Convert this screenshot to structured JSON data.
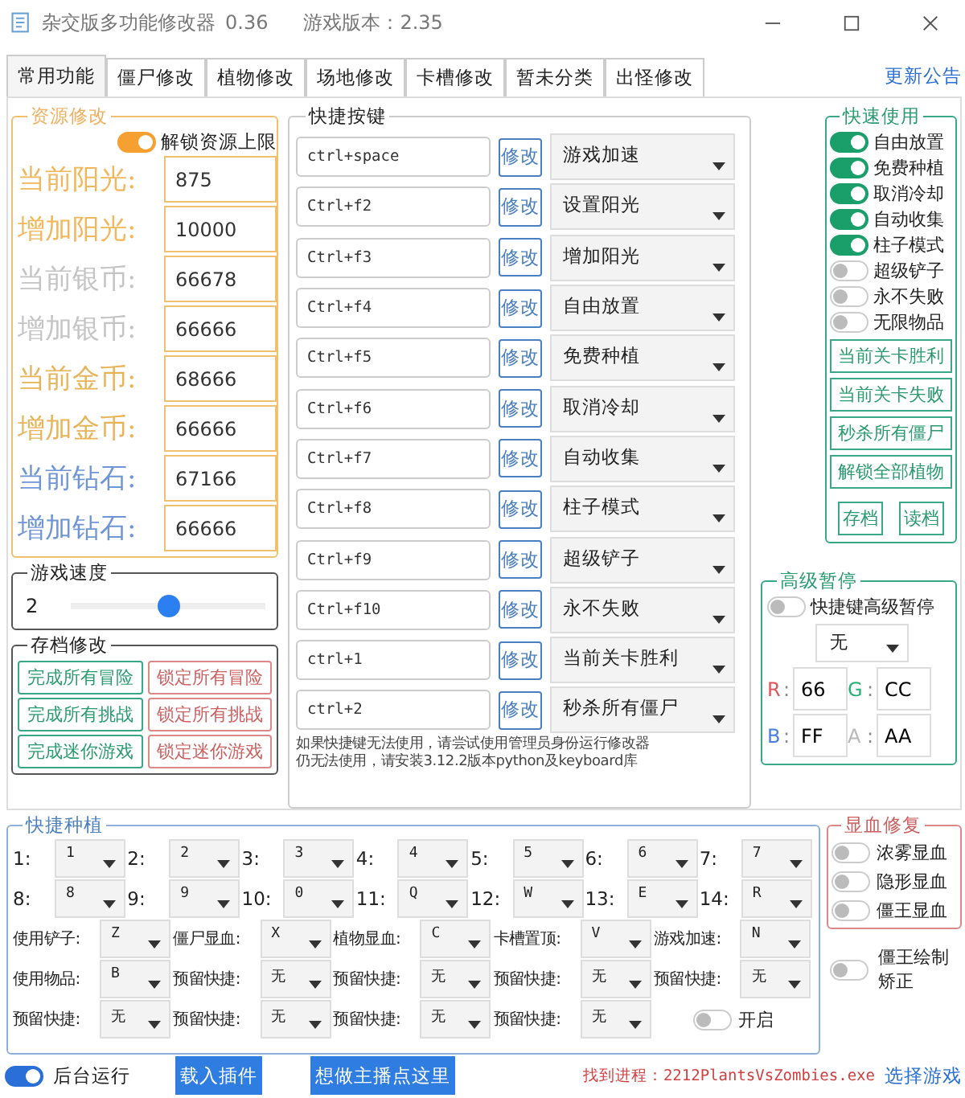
{
  "window": {
    "title": "杂交版多功能修改器",
    "version": "0.36",
    "game_version": "游戏版本：2.35"
  },
  "tabs": [
    {
      "label": "常用功能",
      "selected": true
    },
    {
      "label": "僵尸修改",
      "selected": false
    },
    {
      "label": "植物修改",
      "selected": false
    },
    {
      "label": "场地修改",
      "selected": false
    },
    {
      "label": "卡槽修改",
      "selected": false
    },
    {
      "label": "暂未分类",
      "selected": false
    },
    {
      "label": "出怪修改",
      "selected": false
    }
  ],
  "announcement_link": "更新公告",
  "resources": {
    "title": "资源修改",
    "unlock": {
      "label": "解锁资源上限",
      "on": true
    },
    "rows": [
      {
        "label": "当前阳光:",
        "value": "875",
        "color": "#f2b75c"
      },
      {
        "label": "增加阳光:",
        "value": "10000",
        "color": "#f2b75c"
      },
      {
        "label": "当前银币:",
        "value": "66678",
        "color": "#c4c4c4"
      },
      {
        "label": "增加银币:",
        "value": "66666",
        "color": "#c4c4c4"
      },
      {
        "label": "当前金币:",
        "value": "68666",
        "color": "#e8b45a"
      },
      {
        "label": "增加金币:",
        "value": "66666",
        "color": "#e8b45a"
      },
      {
        "label": "当前钻石:",
        "value": "67166",
        "color": "#6f95d6"
      },
      {
        "label": "增加钻石:",
        "value": "66666",
        "color": "#6f95d6"
      }
    ]
  },
  "speed": {
    "title": "游戏速度",
    "value": "2",
    "level": 0.5
  },
  "save": {
    "title": "存档修改",
    "buttons": [
      {
        "label": "完成所有冒险",
        "kind": "complete"
      },
      {
        "label": "锁定所有冒险",
        "kind": "lock"
      },
      {
        "label": "完成所有挑战",
        "kind": "complete"
      },
      {
        "label": "锁定所有挑战",
        "kind": "lock"
      },
      {
        "label": "完成迷你游戏",
        "kind": "complete"
      },
      {
        "label": "锁定迷你游戏",
        "kind": "lock"
      }
    ]
  },
  "hotkeys": {
    "title": "快捷按键",
    "rows": [
      {
        "key": "ctrl+space",
        "button": "修改",
        "action": "游戏加速"
      },
      {
        "key": "Ctrl+f2",
        "button": "修改",
        "action": "设置阳光"
      },
      {
        "key": "Ctrl+f3",
        "button": "修改",
        "action": "增加阳光"
      },
      {
        "key": "Ctrl+f4",
        "button": "修改",
        "action": "自由放置"
      },
      {
        "key": "Ctrl+f5",
        "button": "修改",
        "action": "免费种植"
      },
      {
        "key": "Ctrl+f6",
        "button": "修改",
        "action": "取消冷却"
      },
      {
        "key": "Ctrl+f7",
        "button": "修改",
        "action": "自动收集"
      },
      {
        "key": "Ctrl+f8",
        "button": "修改",
        "action": "柱子模式"
      },
      {
        "key": "Ctrl+f9",
        "button": "修改",
        "action": "超级铲子"
      },
      {
        "key": "Ctrl+f10",
        "button": "修改",
        "action": "永不失败"
      },
      {
        "key": "ctrl+1",
        "button": "修改",
        "action": "当前关卡胜利"
      },
      {
        "key": "ctrl+2",
        "button": "修改",
        "action": "秒杀所有僵尸"
      }
    ],
    "notes": [
      "如果快捷键无法使用，请尝试使用管理员身份运行修改器",
      "仍无法使用，请安装3.12.2版本python及keyboard库"
    ]
  },
  "quick_use": {
    "title": "快速使用",
    "toggles": [
      {
        "label": "自由放置",
        "on": true
      },
      {
        "label": "免费种植",
        "on": true
      },
      {
        "label": "取消冷却",
        "on": true
      },
      {
        "label": "自动收集",
        "on": true
      },
      {
        "label": "柱子模式",
        "on": true
      },
      {
        "label": "超级铲子",
        "on": false
      },
      {
        "label": "永不失败",
        "on": false
      },
      {
        "label": "无限物品",
        "on": false
      }
    ],
    "buttons": [
      "当前关卡胜利",
      "当前关卡失败",
      "秒杀所有僵尸",
      "解锁全部植物"
    ],
    "small_buttons": [
      "存档",
      "读档"
    ]
  },
  "advanced_pause": {
    "title": "高级暂停",
    "toggle": {
      "label": "快捷键高级暂停",
      "on": false
    },
    "dropdown": "无",
    "channels": [
      {
        "name": "R",
        "separator": ":",
        "value": "66",
        "color": "#e05555"
      },
      {
        "name": "G",
        "separator": ":",
        "value": "CC",
        "color": "#2bb07a"
      },
      {
        "name": "B",
        "separator": ":",
        "value": "FF",
        "color": "#4a7fe0"
      },
      {
        "name": "A",
        "separator": ":",
        "value": "AA",
        "color": "#b8b8b8"
      }
    ]
  },
  "quick_plant": {
    "title": "快捷种植",
    "slots": [
      {
        "label": "1:",
        "value": "1"
      },
      {
        "label": "2:",
        "value": "2"
      },
      {
        "label": "3:",
        "value": "3"
      },
      {
        "label": "4:",
        "value": "4"
      },
      {
        "label": "5:",
        "value": "5"
      },
      {
        "label": "6:",
        "value": "6"
      },
      {
        "label": "7:",
        "value": "7"
      },
      {
        "label": "8:",
        "value": "8"
      },
      {
        "label": "9:",
        "value": "9"
      },
      {
        "label": "10:",
        "value": "0"
      },
      {
        "label": "11:",
        "value": "Q"
      },
      {
        "label": "12:",
        "value": "W"
      },
      {
        "label": "13:",
        "value": "E"
      },
      {
        "label": "14:",
        "value": "R"
      }
    ],
    "bindings": [
      {
        "label": "使用铲子:",
        "value": "Z"
      },
      {
        "label": "僵尸显血:",
        "value": "X"
      },
      {
        "label": "植物显血:",
        "value": "C"
      },
      {
        "label": "卡槽置顶:",
        "value": "V"
      },
      {
        "label": "游戏加速:",
        "value": "N"
      },
      {
        "label": "使用物品:",
        "value": "B"
      },
      {
        "label": "预留快捷:",
        "value": "无"
      },
      {
        "label": "预留快捷:",
        "value": "无"
      },
      {
        "label": "预留快捷:",
        "value": "无"
      },
      {
        "label": "预留快捷:",
        "value": "无"
      },
      {
        "label": "预留快捷:",
        "value": "无"
      },
      {
        "label": "预留快捷:",
        "value": "无"
      },
      {
        "label": "预留快捷:",
        "value": "无"
      },
      {
        "label": "预留快捷:",
        "value": "无"
      }
    ],
    "toggle": {
      "label": "开启",
      "on": false
    }
  },
  "hp_display": {
    "title": "显血修复",
    "toggles": [
      {
        "label": "浓雾显血",
        "on": false
      },
      {
        "label": "隐形显血",
        "on": false
      },
      {
        "label": "僵王显血",
        "on": false
      }
    ]
  },
  "boss_fix": {
    "label": "僵王绘制矫正",
    "on": false
  },
  "status_bar": {
    "background": {
      "label": "后台运行",
      "on": true
    },
    "buttons": [
      "载入插件",
      "想做主播点这里"
    ],
    "process": "找到进程：2212PlantsVsZombies.exe",
    "link": "选择游戏"
  }
}
